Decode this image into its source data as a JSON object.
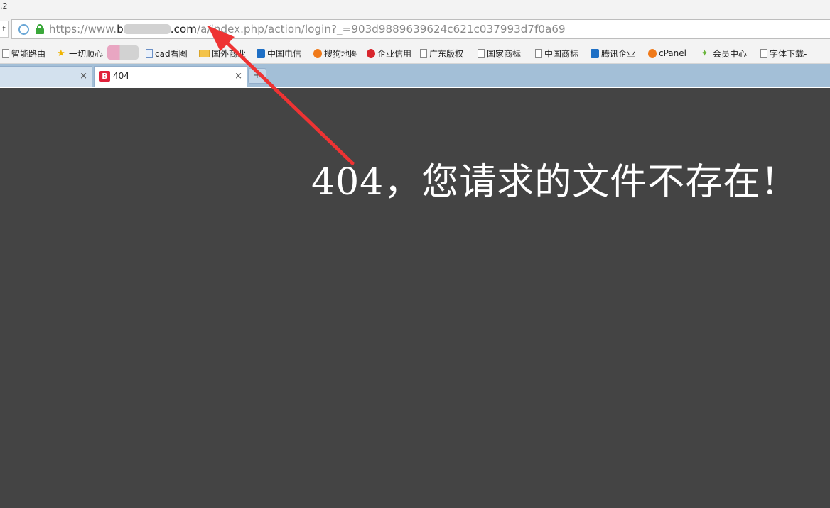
{
  "browser": {
    "version_fragment": ".2",
    "back_fragment": "t",
    "address": {
      "scheme": "https://www.",
      "host_visible_start": "b",
      "host_visible_end": ".com",
      "path": "/a/index.php/action/login?_=903d9889639624c621c037993d7f0a69"
    },
    "bookmarks": [
      {
        "label": "智能路由",
        "icon": "page-icon"
      },
      {
        "label": "一切顺心",
        "icon": "star-icon"
      },
      {
        "label": "cad看图",
        "icon": "doc-icon"
      },
      {
        "label": "国外商业",
        "icon": "folder-icon"
      },
      {
        "label": "中国电信",
        "icon": "telecom-icon"
      },
      {
        "label": "搜狗地图",
        "icon": "sogou-icon"
      },
      {
        "label": "企业信用",
        "icon": "badge-icon"
      },
      {
        "label": "广东版权",
        "icon": "page-icon"
      },
      {
        "label": "国家商标",
        "icon": "page-icon"
      },
      {
        "label": "中国商标",
        "icon": "page-icon"
      },
      {
        "label": "腾讯企业",
        "icon": "tencent-icon"
      },
      {
        "label": "cPanel",
        "icon": "cpanel-icon"
      },
      {
        "label": "会员中心",
        "icon": "green-star-icon"
      },
      {
        "label": "字体下载-",
        "icon": "page-icon"
      }
    ],
    "tabs": [
      {
        "title": "",
        "close": "×"
      },
      {
        "title": "404",
        "favicon": "B",
        "close": "×"
      }
    ],
    "new_tab": "+"
  },
  "page": {
    "message": "404，您请求的文件不存在！"
  },
  "colors": {
    "page_background": "#444444",
    "message_text": "#ffffff",
    "annotation_arrow": "#ee3333"
  }
}
